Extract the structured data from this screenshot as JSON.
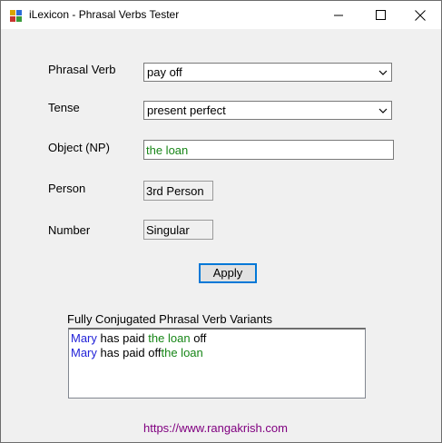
{
  "window": {
    "title": "iLexicon - Phrasal Verbs Tester",
    "icon": "app-icon",
    "controls": [
      "minimize-icon",
      "maximize-icon",
      "close-icon"
    ]
  },
  "form": {
    "phrasal_verb": {
      "label": "Phrasal Verb",
      "value": "pay off"
    },
    "tense": {
      "label": "Tense",
      "value": "present perfect"
    },
    "object": {
      "label": "Object (NP)",
      "value": "the loan"
    },
    "person": {
      "label": "Person",
      "value": "3rd Person"
    },
    "number": {
      "label": "Number",
      "value": "Singular"
    },
    "apply_label": "Apply"
  },
  "variants": {
    "label": "Fully Conjugated Phrasal Verb Variants",
    "items": [
      {
        "subject": "Mary",
        "verb_part1": "has paid",
        "object": "the loan",
        "verb_part2": "off"
      },
      {
        "subject": "Mary",
        "verb_part1": "has paid off",
        "object": "the loan",
        "verb_part2": ""
      }
    ]
  },
  "footer": {
    "url": "https://www.rangakrish.com"
  },
  "colors": {
    "subject": "#2323d8",
    "object": "#178617",
    "link": "#800080",
    "focus_border": "#0078d7"
  }
}
